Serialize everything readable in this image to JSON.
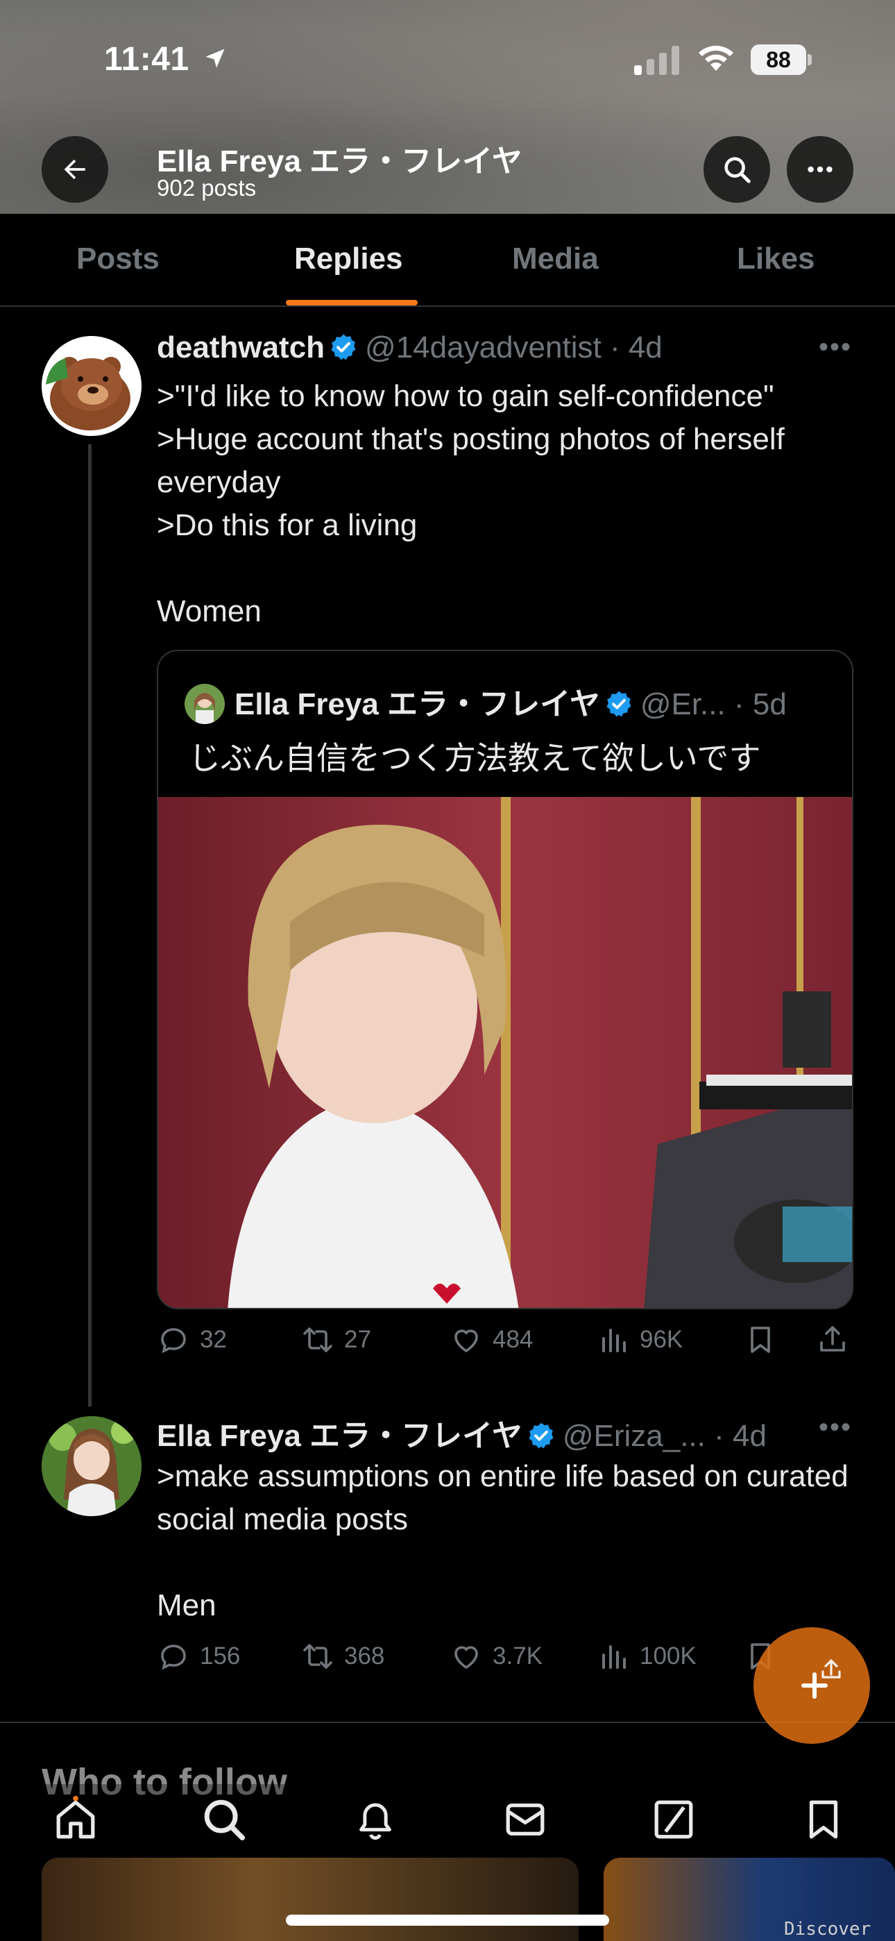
{
  "status_bar": {
    "time": "11:41",
    "battery": "88"
  },
  "header": {
    "title": "Ella Freya エラ・フレイヤ",
    "post_count": "902 posts"
  },
  "tabs": [
    {
      "label": "Posts",
      "active": false
    },
    {
      "label": "Replies",
      "active": true
    },
    {
      "label": "Media",
      "active": false
    },
    {
      "label": "Likes",
      "active": false
    }
  ],
  "accent_color": "#ff7a1a",
  "tweets": [
    {
      "name": "deathwatch",
      "handle": "@14dayadventist",
      "time": "· 4d",
      "text": ">\"I'd like to know how to gain self-confidence\"\n>Huge account that's posting photos of herself everyday\n>Do this for a living\n\nWomen",
      "quote": {
        "name": "Ella Freya エラ・フレイヤ",
        "handle": "@Er...",
        "time": "· 5d",
        "text": "じぶん自信をつく方法教えて欲しいです"
      },
      "stats": {
        "replies": "32",
        "reposts": "27",
        "likes": "484",
        "views": "96K"
      }
    },
    {
      "name": "Ella Freya エラ・フレイヤ",
      "handle": "@Eriza_...",
      "time": "· 4d",
      "text": ">make assumptions on entire life based on curated social media posts\n\nMen",
      "stats": {
        "replies": "156",
        "reposts": "368",
        "likes": "3.7K",
        "views": "100K"
      }
    }
  ],
  "who_to_follow": "Who to follow",
  "discover_label": "Discover"
}
